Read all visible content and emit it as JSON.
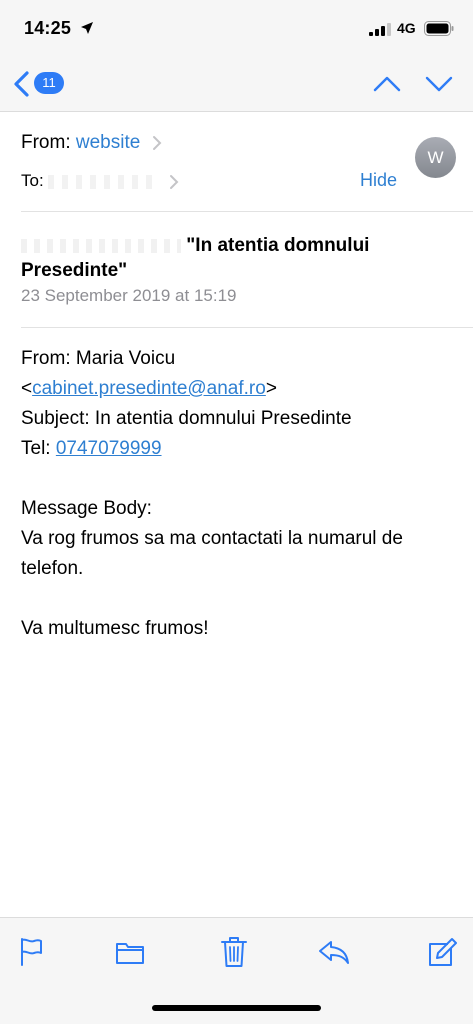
{
  "status_bar": {
    "time": "14:25",
    "network": "4G",
    "icons": [
      "location-arrow-icon",
      "signal-bars-icon",
      "battery-icon"
    ]
  },
  "nav": {
    "back_badge_count": "11",
    "icons": [
      "back-chevron-icon",
      "previous-message-icon",
      "next-message-icon"
    ]
  },
  "header": {
    "from_label": "From:",
    "from_sender": "website",
    "to_label": "To:",
    "hide_label": "Hide",
    "avatar_initial": "W",
    "subject": "\"In atentia domnului Presedinte\"",
    "date": "23 September 2019 at 15:19"
  },
  "body": {
    "from_line": "From: Maria Voicu",
    "email_open": "<",
    "email": "cabinet.presedinte@anaf.ro",
    "email_close": ">",
    "subject_line": "Subject: In atentia domnului Presedinte",
    "tel_label": "Tel: ",
    "tel": "0747079999",
    "message_label": "Message Body:",
    "message": "Va rog frumos sa ma contactati la numarul de telefon.",
    "closing": "Va multumesc frumos!"
  },
  "toolbar": {
    "items": [
      "flag-icon",
      "folder-icon",
      "trash-icon",
      "reply-icon",
      "compose-icon"
    ]
  },
  "colors": {
    "accent": "#2e7fd1",
    "badge": "#2e7cf6",
    "secondary_text": "#8e8e93",
    "bar_background": "#f6f6f6"
  }
}
